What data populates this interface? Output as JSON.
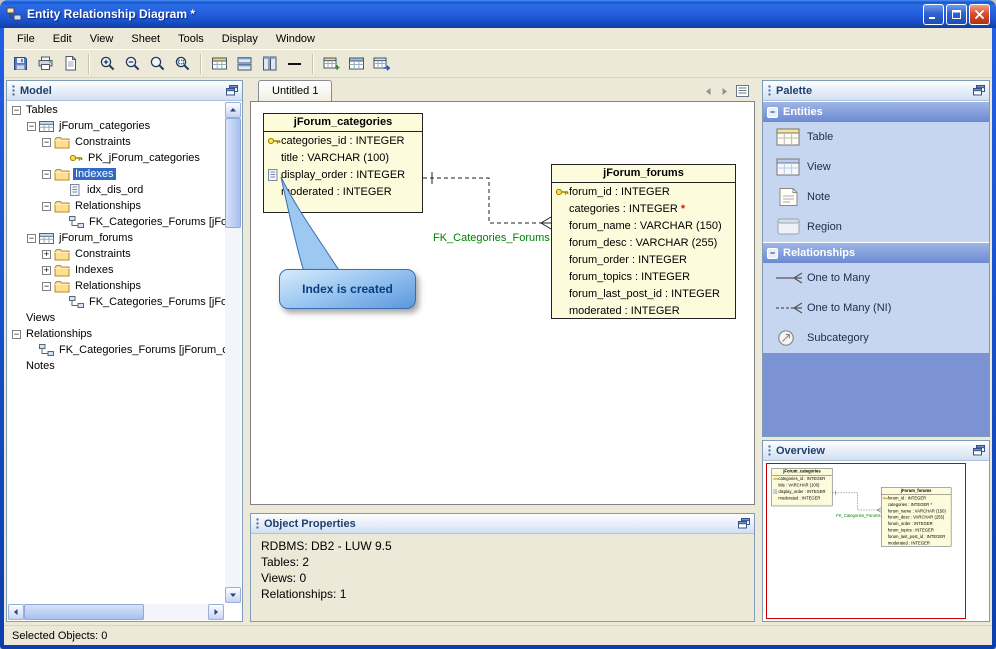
{
  "window": {
    "title": "Entity Relationship Diagram *"
  },
  "menubar": {
    "items": [
      "File",
      "Edit",
      "View",
      "Sheet",
      "Tools",
      "Display",
      "Window"
    ]
  },
  "toolbar": {
    "groups": [
      [
        "save",
        "print",
        "page"
      ],
      [
        "zoom-in",
        "zoom-out",
        "zoom",
        "zoom-area"
      ],
      [
        "table-grid",
        "tile-horizontal",
        "tile-vertical",
        "hline"
      ],
      [
        "table-new",
        "table-columns",
        "table-export"
      ]
    ]
  },
  "model": {
    "title": "Model",
    "tree": [
      {
        "label": "Tables",
        "level": 0,
        "exp": "-"
      },
      {
        "label": "jForum_categories",
        "level": 1,
        "exp": "-",
        "icon": "table"
      },
      {
        "label": "Constraints",
        "level": 2,
        "exp": "-",
        "icon": "folder"
      },
      {
        "label": "PK_jForum_categories",
        "level": 3,
        "icon": "key"
      },
      {
        "label": "Indexes",
        "level": 2,
        "exp": "-",
        "icon": "folder",
        "selected": true
      },
      {
        "label": "idx_dis_ord",
        "level": 3,
        "icon": "index"
      },
      {
        "label": "Relationships",
        "level": 2,
        "exp": "-",
        "icon": "folder"
      },
      {
        "label": "FK_Categories_Forums [jFo",
        "level": 3,
        "icon": "fk"
      },
      {
        "label": "jForum_forums",
        "level": 1,
        "exp": "-",
        "icon": "table"
      },
      {
        "label": "Constraints",
        "level": 2,
        "exp": "+",
        "icon": "folder"
      },
      {
        "label": "Indexes",
        "level": 2,
        "exp": "+",
        "icon": "folder"
      },
      {
        "label": "Relationships",
        "level": 2,
        "exp": "-",
        "icon": "folder"
      },
      {
        "label": "FK_Categories_Forums [jFo",
        "level": 3,
        "icon": "fk"
      },
      {
        "label": "Views",
        "level": 0
      },
      {
        "label": "Relationships",
        "level": 0,
        "exp": "-"
      },
      {
        "label": "FK_Categories_Forums [jForum_ca...",
        "level": 1,
        "icon": "fk"
      },
      {
        "label": "Notes",
        "level": 0
      }
    ]
  },
  "canvas": {
    "tab": "Untitled 1",
    "fk_label": "FK_Categories_Forums",
    "callout": "Index is created",
    "entities": [
      {
        "name": "jForum_categories",
        "columns": [
          {
            "icon": "key",
            "text": "categories_id : INTEGER"
          },
          {
            "icon": "",
            "text": "title : VARCHAR (100)"
          },
          {
            "icon": "index",
            "text": "display_order : INTEGER"
          },
          {
            "icon": "",
            "text": "moderated : INTEGER"
          }
        ]
      },
      {
        "name": "jForum_forums",
        "columns": [
          {
            "icon": "key",
            "text": "forum_id : INTEGER"
          },
          {
            "icon": "",
            "text": "categories : INTEGER",
            "star": "*"
          },
          {
            "icon": "",
            "text": "forum_name : VARCHAR (150)"
          },
          {
            "icon": "",
            "text": "forum_desc : VARCHAR (255)"
          },
          {
            "icon": "",
            "text": "forum_order : INTEGER"
          },
          {
            "icon": "",
            "text": "forum_topics : INTEGER"
          },
          {
            "icon": "",
            "text": "forum_last_post_id : INTEGER"
          },
          {
            "icon": "",
            "text": "moderated : INTEGER"
          }
        ]
      }
    ]
  },
  "object_properties": {
    "title": "Object Properties",
    "lines": [
      "RDBMS: DB2 - LUW 9.5",
      "Tables: 2",
      "Views: 0",
      "Relationships: 1"
    ]
  },
  "palette": {
    "title": "Palette",
    "sections": [
      {
        "label": "Entities",
        "items": [
          {
            "icon": "table",
            "label": "Table"
          },
          {
            "icon": "view",
            "label": "View"
          },
          {
            "icon": "note",
            "label": "Note"
          },
          {
            "icon": "region",
            "label": "Region"
          }
        ]
      },
      {
        "label": "Relationships",
        "items": [
          {
            "icon": "one-to-many",
            "label": "One to Many"
          },
          {
            "icon": "one-to-many-ni",
            "label": "One to Many (NI)"
          },
          {
            "icon": "subcategory",
            "label": "Subcategory"
          }
        ]
      }
    ]
  },
  "overview": {
    "title": "Overview"
  },
  "statusbar": {
    "text": "Selected Objects: 0"
  },
  "colors": {
    "selection": "#316ac5",
    "entity_fill": "#fcfbdc",
    "fk_label": "#008000",
    "callout_fill": "#9dc8f2",
    "viewport_border": "#cc0000"
  }
}
